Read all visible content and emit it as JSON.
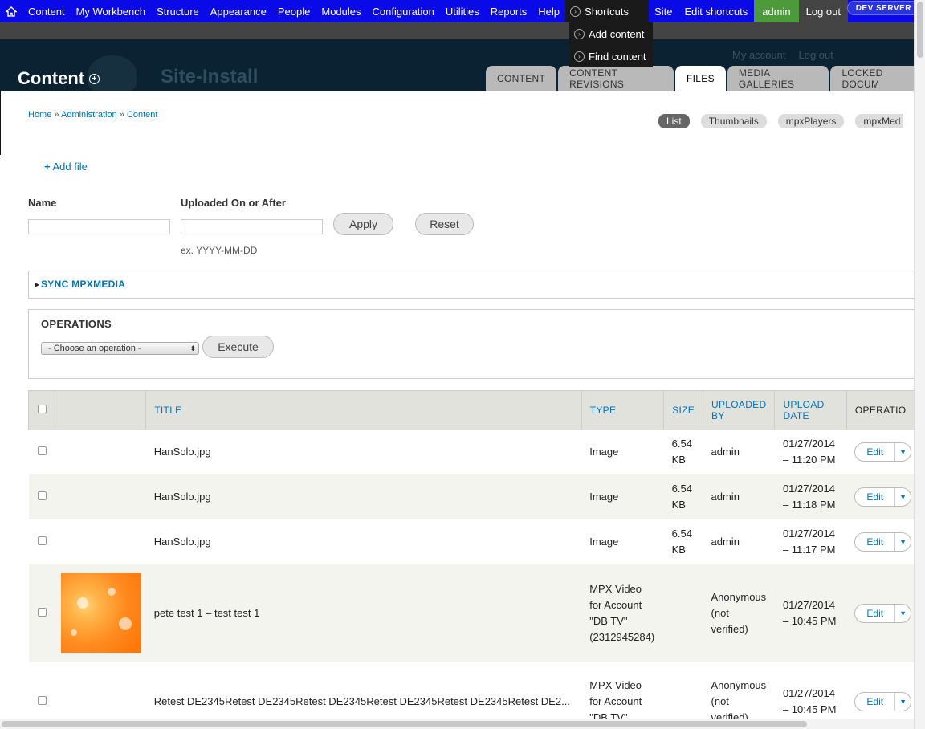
{
  "toolbar": {
    "items": [
      "Content",
      "My Workbench",
      "Structure",
      "Appearance",
      "People",
      "Modules",
      "Configuration",
      "Utilities",
      "Reports",
      "Help"
    ],
    "shortcuts": "Shortcuts",
    "site_fragment": "Site",
    "edit_shortcuts": "Edit shortcuts",
    "admin": "admin",
    "logout": "Log out",
    "dev_server": "DEV SERVER"
  },
  "shortcut_menu": [
    "Add content",
    "Find content"
  ],
  "header": {
    "title": "Content",
    "site_name": "Site-Install",
    "my_account": "My account",
    "log_out": "Log out",
    "tabs": [
      "CONTENT",
      "CONTENT REVISIONS",
      "FILES",
      "MEDIA GALLERIES",
      "LOCKED DOCUM"
    ]
  },
  "breadcrumb": {
    "home": "Home",
    "sep": "»",
    "admin": "Administration",
    "content": "Content"
  },
  "view_pills": [
    "List",
    "Thumbnails",
    "mpxPlayers",
    "mpxMed"
  ],
  "add_file": "Add file",
  "filters": {
    "name_label": "Name",
    "date_label": "Uploaded On or After",
    "date_hint": "ex. YYYY-MM-DD",
    "apply": "Apply",
    "reset": "Reset"
  },
  "sync_label": "SYNC MPXMEDIA",
  "operations": {
    "label": "OPERATIONS",
    "select": "- Choose an operation -",
    "execute": "Execute"
  },
  "table": {
    "headers": [
      "TITLE",
      "TYPE",
      "SIZE",
      "UPLOADED BY",
      "UPLOAD DATE",
      "OPERATIO"
    ],
    "rows": [
      {
        "title": "HanSolo.jpg",
        "type": "Image",
        "size": "6.54 KB",
        "by": "admin",
        "date": "01/27/2014 – 11:20 PM",
        "edit": "Edit"
      },
      {
        "title": "HanSolo.jpg",
        "type": "Image",
        "size": "6.54 KB",
        "by": "admin",
        "date": "01/27/2014 – 11:18 PM",
        "edit": "Edit"
      },
      {
        "title": "HanSolo.jpg",
        "type": "Image",
        "size": "6.54 KB",
        "by": "admin",
        "date": "01/27/2014 – 11:17 PM",
        "edit": "Edit"
      },
      {
        "title": "pete test 1 – test test 1",
        "type": "MPX Video for Account \"DB TV\" (2312945284)",
        "size": "",
        "by": "Anonymous (not verified)",
        "date": "01/27/2014 – 10:45 PM",
        "edit": "Edit"
      },
      {
        "title": "Retest DE2345Retest DE2345Retest DE2345Retest DE2345Retest DE2345Retest DE2...",
        "type": "MPX Video for Account \"DB TV\"",
        "size": "",
        "by": "Anonymous (not verified)",
        "date": "01/27/2014 – 10:45 PM",
        "edit": "Edit"
      }
    ]
  }
}
